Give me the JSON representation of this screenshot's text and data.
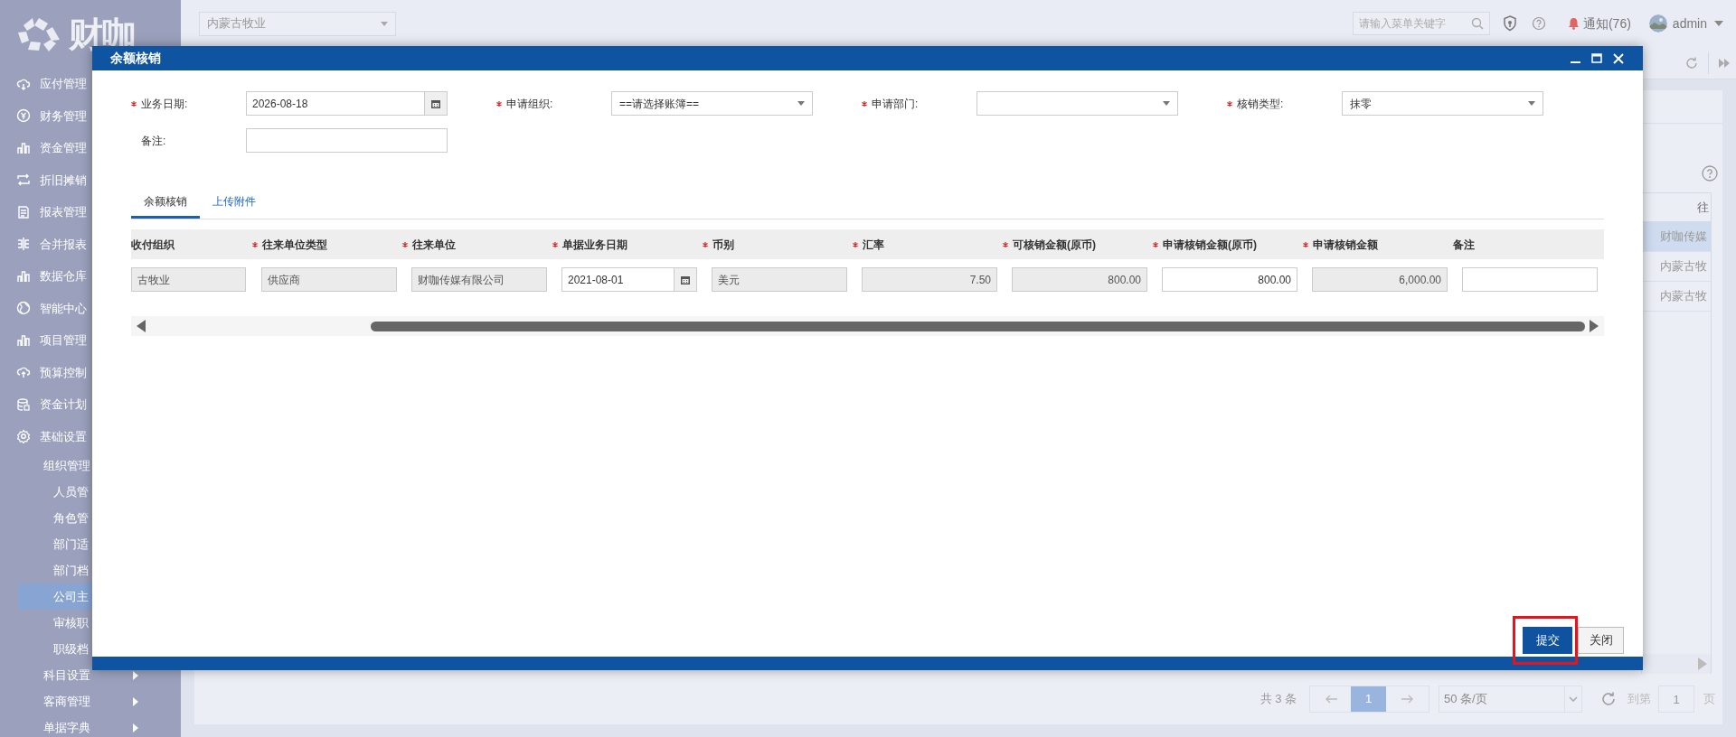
{
  "sidebar": {
    "logo": "财咖",
    "items": [
      {
        "label": "应付管理"
      },
      {
        "label": "财务管理"
      },
      {
        "label": "资金管理"
      },
      {
        "label": "折旧摊销"
      },
      {
        "label": "报表管理"
      },
      {
        "label": "合并报表"
      },
      {
        "label": "数据仓库"
      },
      {
        "label": "智能中心"
      },
      {
        "label": "项目管理"
      },
      {
        "label": "预算控制"
      },
      {
        "label": "资金计划"
      },
      {
        "label": "基础设置",
        "children": [
          {
            "label": "组织管理",
            "expanded": true,
            "children": [
              {
                "label": "人员管",
                "selected": false
              },
              {
                "label": "角色管",
                "selected": false
              },
              {
                "label": "部门适",
                "selected": false
              },
              {
                "label": "部门档",
                "selected": false
              },
              {
                "label": "公司主",
                "selected": true
              },
              {
                "label": "审核职",
                "selected": false
              },
              {
                "label": "职级档",
                "selected": false
              }
            ]
          },
          {
            "label": "科目设置",
            "expanded": false
          },
          {
            "label": "客商管理",
            "expanded": false
          },
          {
            "label": "单据字典",
            "expanded": false
          }
        ]
      }
    ]
  },
  "header": {
    "org_select": "内蒙古牧业",
    "search_placeholder": "请输入菜单关键字",
    "notifications": "通知(76)",
    "user": "admin"
  },
  "background_table": {
    "column_1": "往",
    "rows": [
      {
        "text": "财咖传媒",
        "selected": true
      },
      {
        "text": "内蒙古牧",
        "selected": false
      },
      {
        "text": "内蒙古牧",
        "selected": false
      }
    ]
  },
  "pagination": {
    "total": "共 3 条",
    "pages": [
      {
        "label": "1",
        "selected": true
      }
    ],
    "page_size": "50 条/页",
    "goto_label": "到第",
    "goto_value": "1",
    "goto_suffix": "页"
  },
  "dialog": {
    "title": "余额核销",
    "fields": [
      {
        "kind": "date",
        "label": "业务日期:",
        "required": true,
        "value": "2026-08-18"
      },
      {
        "kind": "select",
        "label": "申请组织:",
        "required": true,
        "value": "==请选择账簿=="
      },
      {
        "kind": "select",
        "label": "申请部门:",
        "required": true
      },
      {
        "kind": "select",
        "label": "核销类型:",
        "required": true,
        "value": "抹零"
      },
      {
        "kind": "text",
        "label": "备注:",
        "required": false
      }
    ],
    "tabs": [
      {
        "label": "余额核销",
        "selected": true
      },
      {
        "label": "上传附件",
        "selected": false
      }
    ],
    "table": {
      "columns": [
        {
          "label": "收付组织",
          "required": false
        },
        {
          "label": "往来单位类型",
          "required": true
        },
        {
          "label": "往来单位",
          "required": true
        },
        {
          "label": "单据业务日期",
          "required": true
        },
        {
          "label": "币别",
          "required": true
        },
        {
          "label": "汇率",
          "required": true
        },
        {
          "label": "可核销金额(原币)",
          "required": true
        },
        {
          "label": "申请核销金额(原币)",
          "required": true
        },
        {
          "label": "申请核销金额",
          "required": true
        },
        {
          "label": "备注",
          "required": false
        }
      ],
      "rows": [
        [
          {
            "kind": "readonly",
            "value": "古牧业"
          },
          {
            "kind": "readonly",
            "value": "供应商"
          },
          {
            "kind": "readonly",
            "value": "财咖传媒有限公司"
          },
          {
            "kind": "date",
            "value": "2021-08-01"
          },
          {
            "kind": "readonly",
            "value": "美元"
          },
          {
            "kind": "readonly_number",
            "value": "7.50"
          },
          {
            "kind": "readonly_number",
            "value": "800.00"
          },
          {
            "kind": "input_number",
            "value": "800.00"
          },
          {
            "kind": "readonly_number",
            "value": "6,000.00"
          },
          {
            "kind": "input"
          }
        ]
      ]
    },
    "buttons": [
      {
        "label": "提交",
        "kind": "primary",
        "highlighted": true
      },
      {
        "label": "关闭",
        "kind": "default",
        "highlighted": false
      }
    ]
  }
}
